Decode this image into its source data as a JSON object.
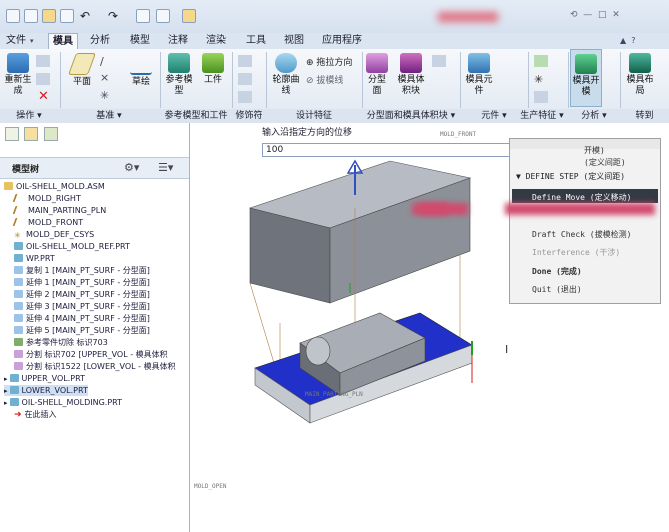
{
  "menubar": {
    "file": "文件",
    "tabs": [
      "模具",
      "分析",
      "模型",
      "注释",
      "渲染",
      "工具",
      "视图",
      "应用程序"
    ]
  },
  "ribbon": {
    "buttons": [
      "重新生成",
      "平面",
      "草绘",
      "参考模型",
      "工件",
      "轮廓曲线",
      "分型面",
      "模具体积块",
      "模具元件",
      "模具开模",
      "模具布局"
    ],
    "small": [
      "拖拉方向",
      "拔模线"
    ],
    "groups": [
      "操作",
      "基准",
      "参考模型和工件",
      "修饰符",
      "设计特征",
      "分型面和模具体积块",
      "元件",
      "生产特征",
      "分析",
      "转到"
    ]
  },
  "tree": {
    "title": "模型树",
    "items": [
      "OIL-SHELL_MOLD.ASM",
      "MOLD_RIGHT",
      "MAIN_PARTING_PLN",
      "MOLD_FRONT",
      "MOLD_DEF_CSYS",
      "OIL-SHELL_MOLD_REF.PRT",
      "WP.PRT",
      "复制 1 [MAIN_PT_SURF - 分型面]",
      "延伸 1 [MAIN_PT_SURF - 分型面]",
      "延伸 2 [MAIN_PT_SURF - 分型面]",
      "延伸 3 [MAIN_PT_SURF - 分型面]",
      "延伸 4 [MAIN_PT_SURF - 分型面]",
      "延伸 5 [MAIN_PT_SURF - 分型面]",
      "参考零件切除 标识703",
      "分割 标识702 [UPPER_VOL - 模具体积",
      "分割 标识1522 [LOWER_VOL - 模具体积",
      "UPPER_VOL.PRT",
      "LOWER_VOL.PRT",
      "OIL-SHELL_MOLDING.PRT",
      "在此插入"
    ]
  },
  "input": {
    "prompt": "输入沿指定方向的位移",
    "value": "100"
  },
  "menu": {
    "items": [
      "开模)",
      "(定义间距)",
      "▼ DEFINE STEP (定义间距)",
      "Define Move (定义移动)",
      "Draft Check (拔模检测)",
      "Interference (干涉)",
      "Done (完成)",
      "Quit (退出)"
    ]
  },
  "viewport": {
    "labels": [
      "MOLD_FRONT",
      "MAIN_PARTING_PLN",
      "MOLD_OPEN"
    ]
  }
}
